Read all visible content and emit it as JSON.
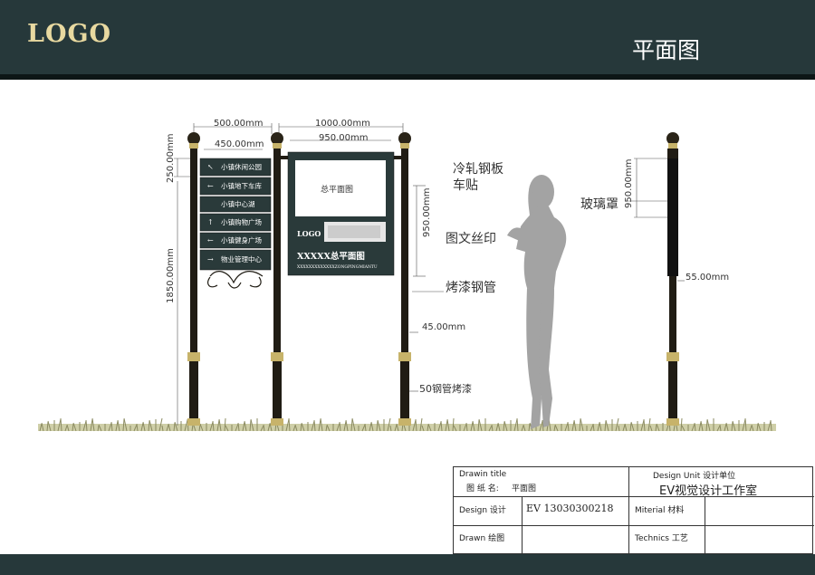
{
  "header": {
    "logo": "LOGO",
    "page_title": "平面图"
  },
  "dimensions": {
    "d500": "500.00mm",
    "d450": "450.00mm",
    "d1000": "1000.00mm",
    "d950_top": "950.00mm",
    "d250": "250.00mm",
    "d1850": "1850.00mm",
    "d950_side": "950.00mm",
    "d45": "45.00mm",
    "d950_right": "950.00mm",
    "d55": "55.00mm"
  },
  "callouts": {
    "cold_rolled_1": "冷轧钢板",
    "cold_rolled_2": "车贴",
    "graphic_print": "图文丝印",
    "painted_pipe": "烤漆钢管",
    "pipe50": "50钢管烤漆",
    "glass_cover": "玻璃罩"
  },
  "sign": {
    "items": [
      {
        "arrow": "↖",
        "text": "小镇休闲公园"
      },
      {
        "arrow": "←",
        "text": "小镇地下车库"
      },
      {
        "arrow": "",
        "text": "小镇中心湖"
      },
      {
        "arrow": "↑",
        "text": "小镇购物广场"
      },
      {
        "arrow": "←",
        "text": "小镇健身广场"
      },
      {
        "arrow": "→",
        "text": "物业管理中心"
      }
    ],
    "map_label": "总平面图",
    "panel_logo": "LOGO",
    "panel_title": "XXXXX总平面图",
    "panel_subtitle": "XXXXXXXXXXXXXZONGPINGMIANTU"
  },
  "title_block": {
    "drawing_title_label": "Drawin title",
    "drawing_name_label": "图  纸  名:",
    "drawing_name_value": "平面图",
    "design_unit_label": "Design Unit  设计单位",
    "design_unit_value": "EV视觉设计工作室",
    "design_label": "Design   设计",
    "design_value": "EV  13030300218",
    "material_label": "Miterial   材料",
    "drawn_label": "Drawn    绘图",
    "technics_label": "Technics   工艺"
  }
}
